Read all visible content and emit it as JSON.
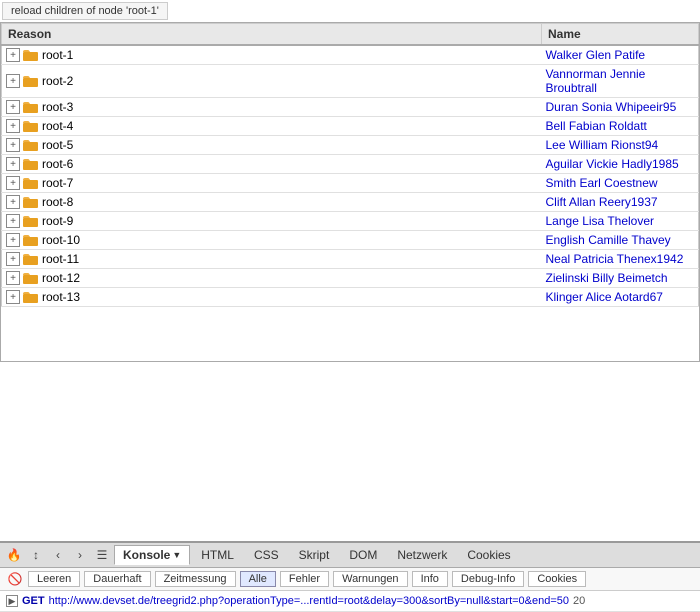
{
  "tooltip": "reload children of node 'root-1'",
  "grid": {
    "col_reason": "Reason",
    "col_name": "Name",
    "rows": [
      {
        "id": "root-1",
        "name": "Walker Glen Patife"
      },
      {
        "id": "root-2",
        "name": "Vannorman Jennie Broubtrall"
      },
      {
        "id": "root-3",
        "name": "Duran Sonia Whipeeir95"
      },
      {
        "id": "root-4",
        "name": "Bell Fabian Roldatt"
      },
      {
        "id": "root-5",
        "name": "Lee William Rionst94"
      },
      {
        "id": "root-6",
        "name": "Aguilar Vickie Hadly1985"
      },
      {
        "id": "root-7",
        "name": "Smith Earl Coestnew"
      },
      {
        "id": "root-8",
        "name": "Clift Allan Reery1937"
      },
      {
        "id": "root-9",
        "name": "Lange Lisa Thelover"
      },
      {
        "id": "root-10",
        "name": "English Camille Thavey"
      },
      {
        "id": "root-11",
        "name": "Neal Patricia Thenex1942"
      },
      {
        "id": "root-12",
        "name": "Zielinski Billy Beimetch"
      },
      {
        "id": "root-13",
        "name": "Klinger Alice Aotard67"
      }
    ]
  },
  "devtools": {
    "icons": {
      "flame": "🔥",
      "cursor": "↕",
      "back": "‹",
      "forward": "›",
      "list": "☰"
    },
    "tabs": [
      {
        "label": "Konsole",
        "active": true,
        "has_arrow": true
      },
      {
        "label": "HTML",
        "active": false
      },
      {
        "label": "CSS",
        "active": false
      },
      {
        "label": "Skript",
        "active": false
      },
      {
        "label": "DOM",
        "active": false
      },
      {
        "label": "Netzwerk",
        "active": false
      },
      {
        "label": "Cookies",
        "active": false
      }
    ],
    "filter_buttons": [
      {
        "label": "Leeren",
        "active": false
      },
      {
        "label": "Dauerhaft",
        "active": false
      },
      {
        "label": "Zeitmessung",
        "active": false
      },
      {
        "label": "Alle",
        "active": true
      },
      {
        "label": "Fehler",
        "active": false
      },
      {
        "label": "Warnungen",
        "active": false
      },
      {
        "label": "Info",
        "active": false
      },
      {
        "label": "Debug-Info",
        "active": false
      },
      {
        "label": "Cookies",
        "active": false
      }
    ],
    "log_entry": {
      "method": "GET",
      "url": "http://www.devset.de/treegrid2.php?operationType=...rentId=root&delay=300&sortBy=null&start=0&end=50",
      "suffix": "20"
    }
  }
}
